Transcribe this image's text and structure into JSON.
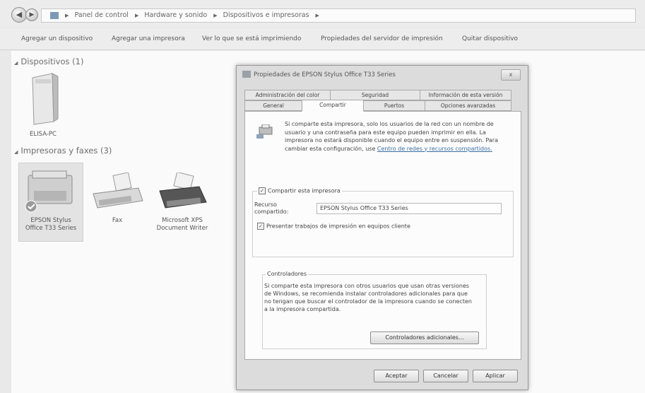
{
  "address_bar": {
    "crumbs": [
      "Panel de control",
      "Hardware y sonido",
      "Dispositivos e impresoras"
    ]
  },
  "toolbar": {
    "items": [
      "Agregar un dispositivo",
      "Agregar una impresora",
      "Ver lo que se está imprimiendo",
      "Propiedades del servidor de impresión",
      "Quitar dispositivo"
    ]
  },
  "devices_group": {
    "title": "Dispositivos (1)",
    "items": [
      "ELISA-PC"
    ]
  },
  "printers_group": {
    "title": "Impresoras y faxes (3)",
    "items": [
      {
        "line1": "EPSON Stylus",
        "line2": "Office T33 Series"
      },
      {
        "line1": "Fax",
        "line2": ""
      },
      {
        "line1": "Microsoft XPS",
        "line2": "Document Writer"
      }
    ]
  },
  "dialog": {
    "title": "Propiedades de EPSON Stylus Office T33 Series",
    "close_label": "x",
    "tabs_row1": [
      "Administración del color",
      "Seguridad",
      "Información de esta versión"
    ],
    "tabs_row2": [
      "General",
      "Compartir",
      "Puertos",
      "Opciones avanzadas"
    ],
    "intro_text": "Si comparte esta impresora, solo los usuarios de la red con un nombre de usuario y una contraseña para este equipo pueden imprimir en ella. La impresora no estará disponible cuando el equipo entre en suspensión. Para cambiar esta configuración, use",
    "intro_link": "Centro de redes y recursos compartidos.",
    "share_checkbox": "Compartir esta impresora",
    "share_name_label_1": "Recurso",
    "share_name_label_2": "compartido:",
    "share_name_value": "EPSON Stylus Office T33 Series",
    "render_checkbox": "Presentar trabajos de impresión en equipos cliente",
    "drivers_group_title": "Controladores",
    "drivers_text": "Si comparte esta impresora con otros usuarios que usan otras versiones de Windows, se recomienda instalar controladores adicionales para que no tengan que buscar el controlador de la impresora cuando se conecten a la impresora compartida.",
    "additional_drivers_button": "Controladores adicionales...",
    "ok_button": "Aceptar",
    "cancel_button": "Cancelar",
    "apply_button": "Aplicar"
  }
}
